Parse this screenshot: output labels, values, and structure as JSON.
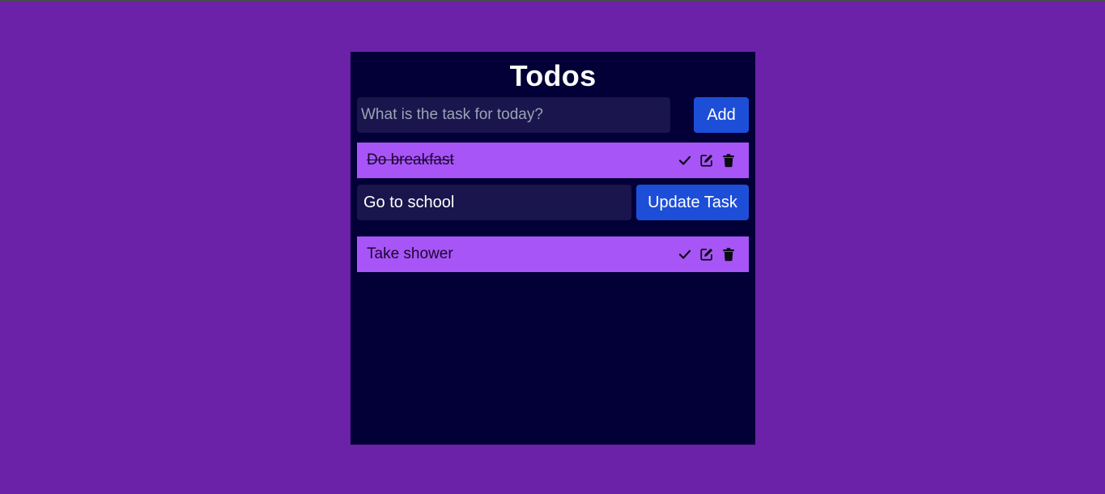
{
  "app": {
    "title": "Todos"
  },
  "add_form": {
    "placeholder": "What is the task for today?",
    "value": "",
    "button_label": "Add"
  },
  "todos": [
    {
      "text": "Do breakfast",
      "completed": true
    },
    {
      "text": "Take shower",
      "completed": false
    }
  ],
  "edit_form": {
    "value": "Go to school",
    "button_label": "Update Task"
  },
  "icons": {
    "complete": "check-icon",
    "edit": "edit-icon",
    "delete": "trash-icon"
  },
  "colors": {
    "page_background": "#6b21a8",
    "panel_background": "#020036",
    "input_background": "#1a154c",
    "todo_background": "#a855f7",
    "button_background": "#1d4ed8"
  }
}
